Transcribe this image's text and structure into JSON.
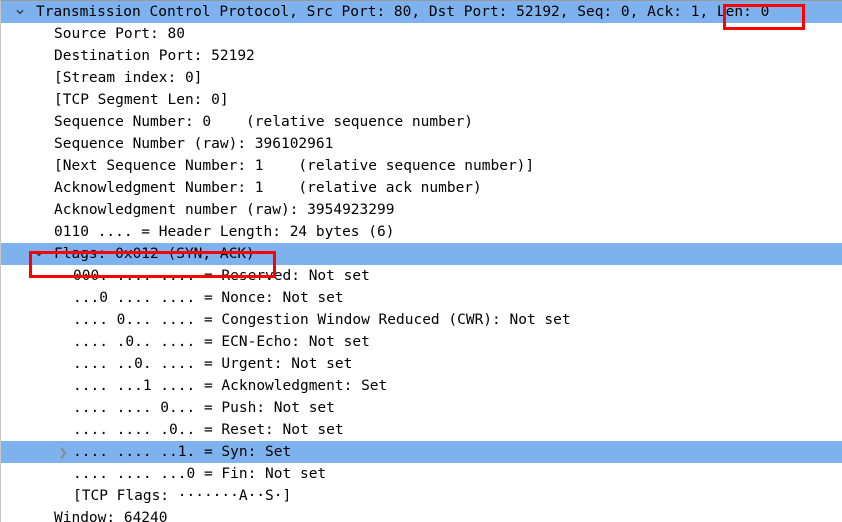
{
  "panel": {
    "name": "packet-details-tree",
    "protocol_summary": "Transmission Control Protocol, Src Port: 80, Dst Port: 52192, Seq: 0, Ack: 1, Len: 0"
  },
  "colors": {
    "selection_blue": "#7eb2ef",
    "annotation_red": "#ff0000",
    "text": "#000000",
    "background": "#ffffff"
  },
  "rows": [
    {
      "id": "tcp-root",
      "text": "Transmission Control Protocol, Src Port: 80, Dst Port: 52192, Seq: 0, Ack: 1, Len: 0",
      "level": 0,
      "selected": true,
      "expander": "chevron-down-icon"
    },
    {
      "id": "source-port",
      "text": "Source Port: 80",
      "level": 1,
      "selected": false,
      "expander": "none"
    },
    {
      "id": "dest-port",
      "text": "Destination Port: 52192",
      "level": 1,
      "selected": false,
      "expander": "none"
    },
    {
      "id": "stream-index",
      "text": "[Stream index: 0]",
      "level": 1,
      "selected": false,
      "expander": "none"
    },
    {
      "id": "segment-len",
      "text": "[TCP Segment Len: 0]",
      "level": 1,
      "selected": false,
      "expander": "none"
    },
    {
      "id": "seq-number",
      "text": "Sequence Number: 0    (relative sequence number)",
      "level": 1,
      "selected": false,
      "expander": "none"
    },
    {
      "id": "seq-number-raw",
      "text": "Sequence Number (raw): 396102961",
      "level": 1,
      "selected": false,
      "expander": "none"
    },
    {
      "id": "next-seq-number",
      "text": "[Next Sequence Number: 1    (relative sequence number)]",
      "level": 1,
      "selected": false,
      "expander": "none"
    },
    {
      "id": "ack-number",
      "text": "Acknowledgment Number: 1    (relative ack number)",
      "level": 1,
      "selected": false,
      "expander": "none"
    },
    {
      "id": "ack-number-raw",
      "text": "Acknowledgment number (raw): 3954923299",
      "level": 1,
      "selected": false,
      "expander": "none"
    },
    {
      "id": "header-length",
      "text": "0110 .... = Header Length: 24 bytes (6)",
      "level": 1,
      "selected": false,
      "expander": "none"
    },
    {
      "id": "flags",
      "text": "Flags: 0x012 (SYN, ACK)",
      "level": 1,
      "selected": true,
      "expander": "chevron-down-icon"
    },
    {
      "id": "flag-reserved",
      "text": "000. .... .... = Reserved: Not set",
      "level": 2,
      "selected": false,
      "expander": "none"
    },
    {
      "id": "flag-nonce",
      "text": "...0 .... .... = Nonce: Not set",
      "level": 2,
      "selected": false,
      "expander": "none"
    },
    {
      "id": "flag-cwr",
      "text": ".... 0... .... = Congestion Window Reduced (CWR): Not set",
      "level": 2,
      "selected": false,
      "expander": "none"
    },
    {
      "id": "flag-ecn-echo",
      "text": ".... .0.. .... = ECN-Echo: Not set",
      "level": 2,
      "selected": false,
      "expander": "none"
    },
    {
      "id": "flag-urgent",
      "text": ".... ..0. .... = Urgent: Not set",
      "level": 2,
      "selected": false,
      "expander": "none"
    },
    {
      "id": "flag-ack",
      "text": ".... ...1 .... = Acknowledgment: Set",
      "level": 2,
      "selected": false,
      "expander": "none"
    },
    {
      "id": "flag-push",
      "text": ".... .... 0... = Push: Not set",
      "level": 2,
      "selected": false,
      "expander": "none"
    },
    {
      "id": "flag-reset",
      "text": ".... .... .0.. = Reset: Not set",
      "level": 2,
      "selected": false,
      "expander": "none"
    },
    {
      "id": "flag-syn",
      "text": ".... .... ..1. = Syn: Set",
      "level": 2,
      "selected": true,
      "expander": "chevron-right-icon"
    },
    {
      "id": "flag-fin",
      "text": ".... .... ...0 = Fin: Not set",
      "level": 2,
      "selected": false,
      "expander": "none"
    },
    {
      "id": "tcp-flags-str",
      "text": "[TCP Flags: ·······A··S·]",
      "level": 2,
      "selected": false,
      "expander": "none"
    },
    {
      "id": "window-size",
      "text": "Window: 64240",
      "level": 1,
      "selected": false,
      "expander": "none"
    }
  ],
  "annotations": [
    {
      "id": "annot-len",
      "name": "highlight-box-len",
      "target_text": "Len: 0"
    },
    {
      "id": "annot-flags",
      "name": "highlight-box-flags",
      "target_text": "Flags: 0x012 (SYN, ACK)"
    }
  ]
}
